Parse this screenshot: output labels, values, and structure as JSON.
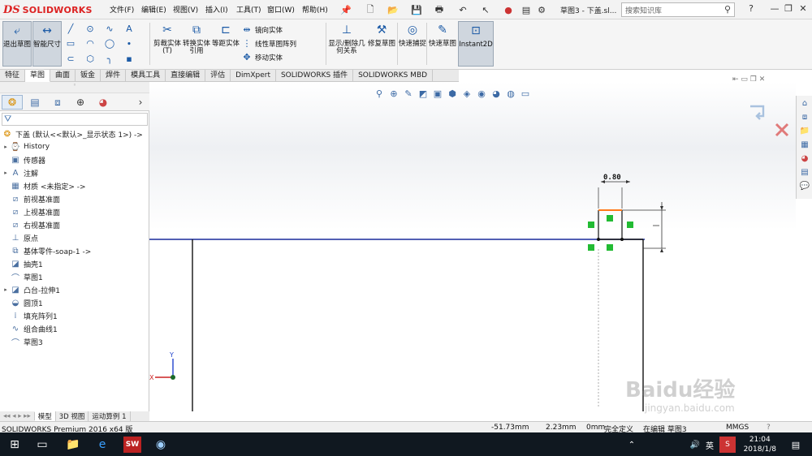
{
  "app": {
    "brand_mark": "DS",
    "brand_name": "SOLIDWORKS",
    "doc_title": "草图3 - 下盖.sl...",
    "search_placeholder": "搜索知识库"
  },
  "menus": [
    "文件(F)",
    "编辑(E)",
    "视图(V)",
    "插入(I)",
    "工具(T)",
    "窗口(W)",
    "帮助(H)"
  ],
  "ribbon": {
    "exit_sketch": "退出草图",
    "smart_dim": "智能尺寸",
    "trim": "剪裁实体(T)",
    "convert": "转换实体引用",
    "offset": "等距实体",
    "mirror": "镜向实体",
    "linear_pattern": "线性草图阵列",
    "move": "移动实体",
    "show_relations": "显示/删除几何关系",
    "repair": "修复草图",
    "quick_snap": "快速捕捉",
    "rapid_sketch": "快速草图",
    "instant2d": "Instant2D"
  },
  "tabs": [
    "特征",
    "草图",
    "曲面",
    "钣金",
    "焊件",
    "模具工具",
    "直接编辑",
    "评估",
    "DimXpert",
    "SOLIDWORKS 插件",
    "SOLIDWORKS MBD"
  ],
  "active_tab": "草图",
  "tree": {
    "root": "下盖 (默认<<默认>_显示状态 1>) ->",
    "items": [
      {
        "label": "History",
        "expandable": true
      },
      {
        "label": "传感器",
        "expandable": false
      },
      {
        "label": "注解",
        "expandable": true
      },
      {
        "label": "材质 <未指定> ->",
        "expandable": false
      },
      {
        "label": "前视基准面",
        "expandable": false
      },
      {
        "label": "上视基准面",
        "expandable": false
      },
      {
        "label": "右视基准面",
        "expandable": false
      },
      {
        "label": "原点",
        "expandable": false
      },
      {
        "label": "基体零件-soap-1 ->",
        "expandable": false
      },
      {
        "label": "抽壳1",
        "expandable": false
      },
      {
        "label": "草图1",
        "expandable": false
      },
      {
        "label": "凸台-拉伸1",
        "expandable": true
      },
      {
        "label": "圆顶1",
        "expandable": false
      },
      {
        "label": "填充阵列1",
        "expandable": false
      },
      {
        "label": "组合曲线1",
        "expandable": false
      },
      {
        "label": "草图3",
        "expandable": false
      }
    ]
  },
  "bottom_tabs": [
    "模型",
    "3D 视图",
    "运动算例 1"
  ],
  "status": {
    "product": "SOLIDWORKS Premium 2016 x64 版",
    "x": "-51.73mm",
    "y": "2.23mm",
    "z": "0mm",
    "state": "完全定义",
    "editing": "在编辑 草图3",
    "units": "MMGS"
  },
  "sketch": {
    "dimension": "0.80"
  },
  "axes": {
    "y": "Y",
    "x": "X"
  },
  "taskbar": {
    "time": "21:04",
    "date": "2018/1/8",
    "ime": "英"
  },
  "watermark": {
    "text": "Baidu经验",
    "url": "jingyan.baidu.com"
  },
  "colors": {
    "sketch_line": "#1a2a9c",
    "constraint": "#22bb33",
    "highlight": "#ff7a1a",
    "brand": "#d22222"
  }
}
